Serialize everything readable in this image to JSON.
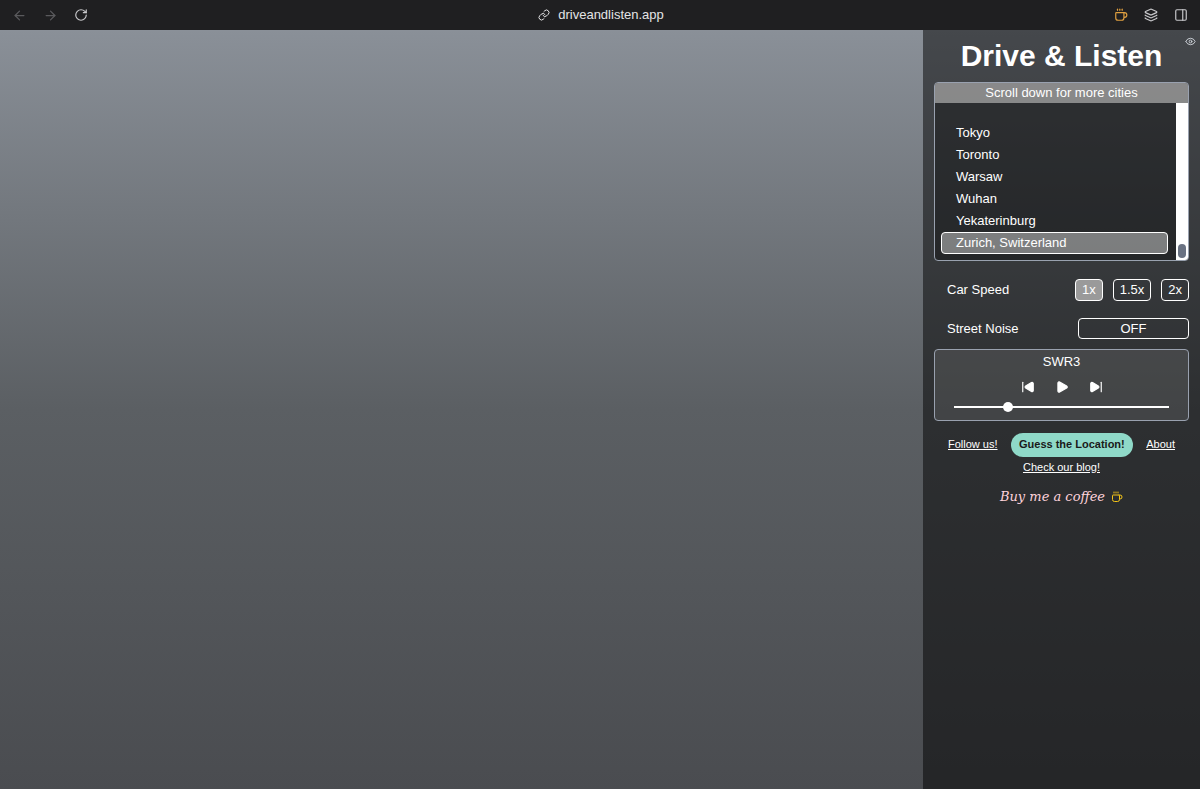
{
  "browser": {
    "url": "driveandlisten.app"
  },
  "panel": {
    "title": "Drive & Listen",
    "cities": {
      "hint": "Scroll down for more cities",
      "items": [
        {
          "label": "Tokyo",
          "selected": false
        },
        {
          "label": "Toronto",
          "selected": false
        },
        {
          "label": "Warsaw",
          "selected": false
        },
        {
          "label": "Wuhan",
          "selected": false
        },
        {
          "label": "Yekaterinburg",
          "selected": false
        },
        {
          "label": "Zurich, Switzerland",
          "selected": true
        }
      ]
    },
    "car_speed": {
      "label": "Car Speed",
      "options": [
        {
          "label": "1x",
          "selected": true
        },
        {
          "label": "1.5x",
          "selected": false
        },
        {
          "label": "2x",
          "selected": false
        }
      ]
    },
    "street_noise": {
      "label": "Street Noise",
      "value": "OFF"
    },
    "radio": {
      "station": "SWR3",
      "playing": false,
      "volume": {
        "level": 0.25
      }
    },
    "links": {
      "follow": "Follow us!",
      "guess": "Guess the Location!",
      "about": "About",
      "blog": "Check our blog!",
      "coffee": "Buy me a coffee"
    }
  }
}
